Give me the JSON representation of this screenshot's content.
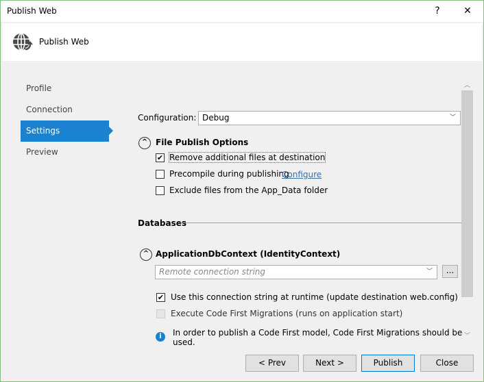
{
  "window": {
    "title": "Publish Web",
    "help": "?",
    "close": "✕"
  },
  "header": {
    "title": "Publish Web",
    "icon": "globe-publish-icon"
  },
  "nav": {
    "items": [
      {
        "label": "Profile"
      },
      {
        "label": "Connection"
      },
      {
        "label": "Settings",
        "selected": true
      },
      {
        "label": "Preview"
      }
    ]
  },
  "settings": {
    "configuration_label": "Configuration:",
    "configuration_value": "Debug",
    "file_publish_header": "File Publish Options",
    "remove_files": {
      "label": "Remove additional files at destination",
      "checked": true
    },
    "precompile": {
      "label": "Precompile during publishing",
      "checked": false,
      "link": "Configure"
    },
    "exclude_app_data": {
      "label": "Exclude files from the App_Data folder",
      "checked": false
    },
    "databases_header": "Databases",
    "db_context": "ApplicationDbContext (IdentityContext)",
    "connection_placeholder": "Remote connection string",
    "browse_label": "...",
    "use_conn_string": {
      "label": "Use this connection string at runtime (update destination web.config)",
      "checked": true
    },
    "code_first": {
      "label": "Execute Code First Migrations (runs on application start)",
      "checked": false,
      "disabled": true
    },
    "info_text": "In order to publish a Code First model, Code First Migrations should be used."
  },
  "buttons": {
    "prev": "< Prev",
    "next": "Next >",
    "publish": "Publish",
    "close": "Close"
  },
  "colors": {
    "accent": "#1a82d0",
    "link": "#3a6ea5",
    "info": "#1a82d0"
  }
}
